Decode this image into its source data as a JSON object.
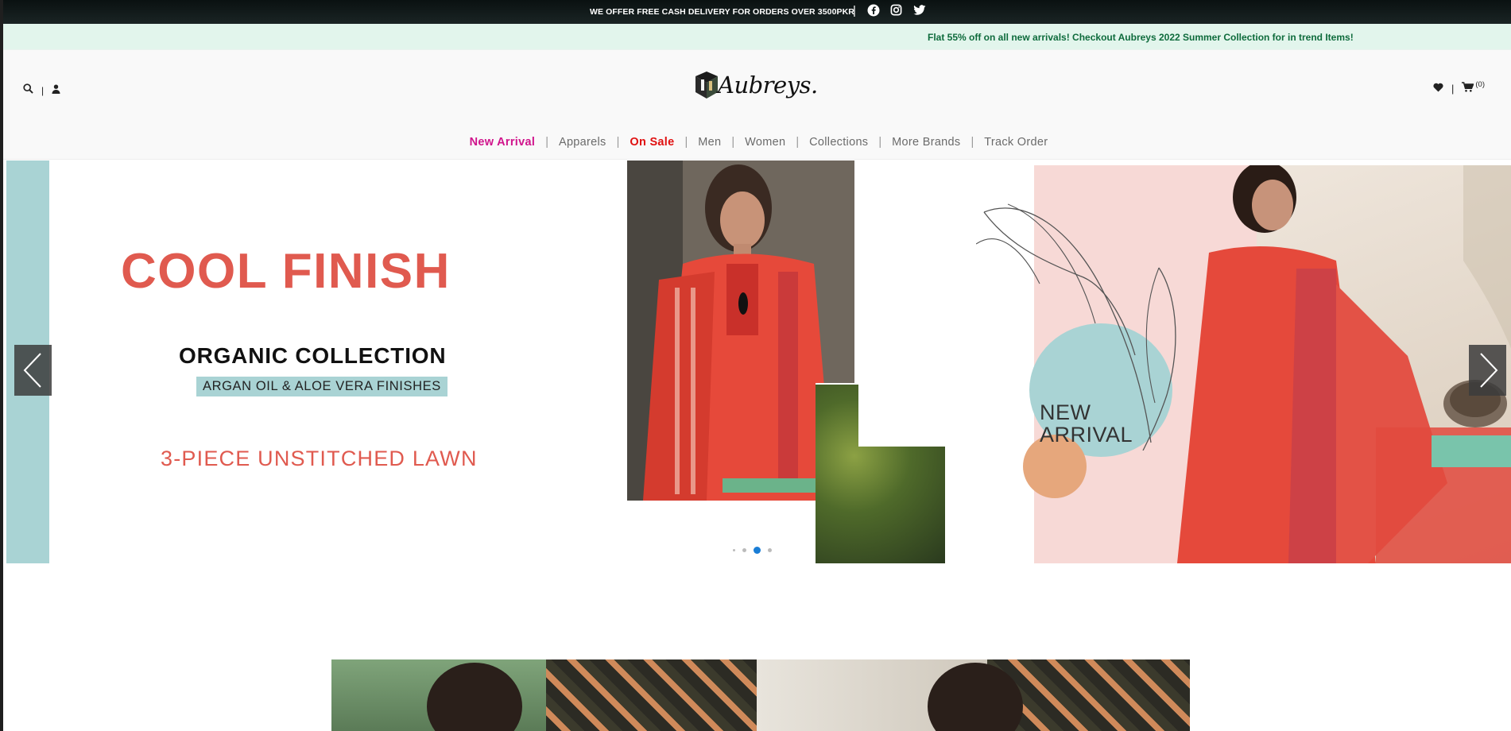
{
  "topbar": {
    "promo": "WE OFFER FREE CASH DELIVERY FOR ORDERS OVER 3500PKR",
    "separator": "|",
    "social_icons": [
      "facebook-icon",
      "instagram-icon",
      "twitter-icon"
    ]
  },
  "marquee": {
    "message": "Flat 55% off on all new arrivals! Checkout Aubreys 2022 Summer Collection for in trend Items!"
  },
  "header": {
    "logo_text": "Aubreys.",
    "left_separator": "|",
    "right_separator": "|",
    "cart_count": "(0)"
  },
  "nav": {
    "items": [
      {
        "label": "New Arrival"
      },
      {
        "label": "Apparels"
      },
      {
        "label": "On Sale"
      },
      {
        "label": "Men"
      },
      {
        "label": "Women"
      },
      {
        "label": "Collections"
      },
      {
        "label": "More Brands"
      },
      {
        "label": "Track Order"
      }
    ],
    "divider": "|"
  },
  "hero": {
    "headline": "COOL FINISH",
    "subheadline": "ORGANIC COLLECTION",
    "tagline": "ARGAN OIL & ALOE VERA FINISHES",
    "product_line": "3-PIECE UNSTITCHED LAWN",
    "badge_line1": "NEW",
    "badge_line2": "ARRIVAL",
    "slide_count": 4,
    "active_slide": 3
  },
  "colors": {
    "accent_pink": "#d0148c",
    "sale_red": "#e01010",
    "hero_coral": "#e05a4f",
    "hero_teal": "#a9d3d4",
    "marquee_bg": "#e2f5ec",
    "marquee_text": "#0e6b3c"
  }
}
